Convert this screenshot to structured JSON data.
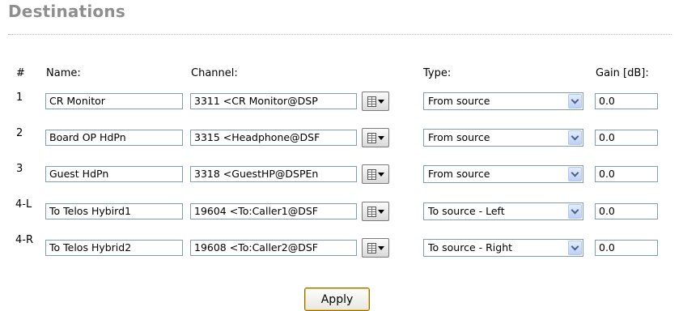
{
  "section": {
    "title": "Destinations"
  },
  "headers": {
    "number": "#",
    "name": "Name:",
    "channel": "Channel:",
    "type": "Type:",
    "gain": "Gain [dB]:"
  },
  "rows": [
    {
      "number": "1",
      "name": "CR Monitor",
      "channel": "3311 <CR Monitor@DSP",
      "type": "From source",
      "gain": "0.0"
    },
    {
      "number": "2",
      "name": "Board OP HdPn",
      "channel": "3315 <Headphone@DSF",
      "type": "From source",
      "gain": "0.0"
    },
    {
      "number": "3",
      "name": "Guest HdPn",
      "channel": "3318 <GuestHP@DSPEn",
      "type": "From source",
      "gain": "0.0"
    },
    {
      "number": "4-L",
      "name": "To Telos Hybird1",
      "channel": "19604 <To:Caller1@DSF",
      "type": "To source - Left",
      "gain": "0.0"
    },
    {
      "number": "4-R",
      "name": "To Telos Hybrid2",
      "channel": "19608 <To:Caller2@DSF",
      "type": "To source - Right",
      "gain": "0.0"
    }
  ],
  "actions": {
    "apply_label": "Apply"
  }
}
